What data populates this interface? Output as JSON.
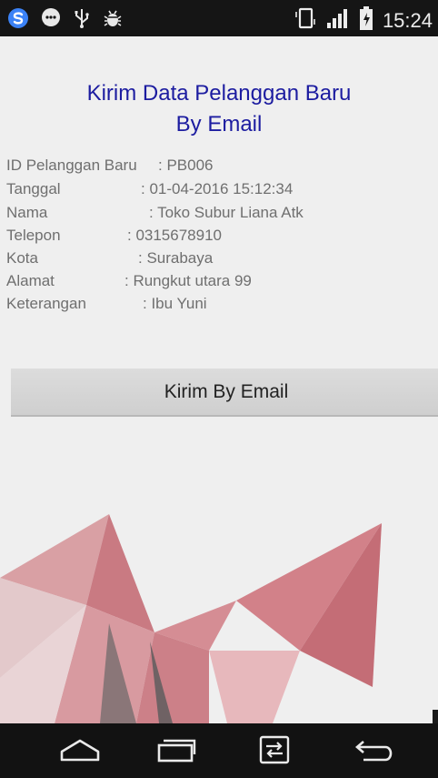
{
  "status_bar": {
    "time": "15:24",
    "left_icons": [
      "s-circle-icon",
      "chat-bubble-icon",
      "usb-icon",
      "android-debug-icon"
    ],
    "right_icons": [
      "vibrate-icon",
      "signal-icon",
      "battery-charging-icon"
    ]
  },
  "screen": {
    "title_line1": "Kirim Data Pelanggan Baru",
    "title_line2": "By Email",
    "fields": [
      {
        "label": "ID Pelanggan Baru",
        "value": ": PB006"
      },
      {
        "label": "Tanggal",
        "value": ": 01-04-2016 15:12:34"
      },
      {
        "label": "Nama",
        "value": ": Toko Subur Liana Atk"
      },
      {
        "label": "Telepon",
        "value": ": 0315678910"
      },
      {
        "label": "Kota",
        "value": ": Surabaya"
      },
      {
        "label": "Alamat",
        "value": ": Rungkut utara 99"
      },
      {
        "label": "Keterangan",
        "value": ": Ibu Yuni"
      }
    ],
    "send_button_label": "Kirim By Email"
  },
  "nav_bar": {
    "buttons": [
      "home-icon",
      "recent-apps-icon",
      "dual-window-icon",
      "back-icon"
    ]
  },
  "colors": {
    "title": "#1c1ca0",
    "watermark_red": "#d9898f",
    "watermark_dark": "#4a4a4a",
    "background": "#efefef"
  }
}
